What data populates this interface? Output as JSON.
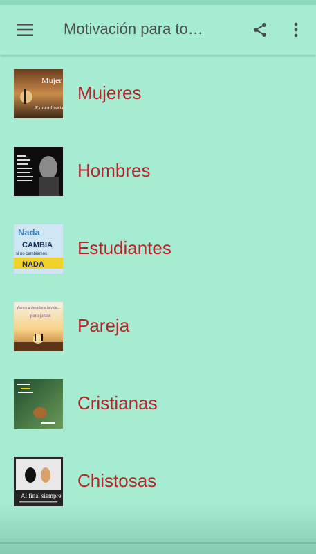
{
  "app_bar": {
    "title": "Motivación para to…",
    "icons": [
      "menu-icon",
      "share-icon",
      "more-vert-icon"
    ]
  },
  "categories": [
    {
      "label": "Mujeres",
      "thumb_text": [
        "Mujer",
        "Extraordinaria"
      ]
    },
    {
      "label": "Hombres",
      "thumb_text": []
    },
    {
      "label": "Estudiantes",
      "thumb_text": [
        "Nada",
        "CAMBIA",
        "si no cambiamos",
        "NADA"
      ]
    },
    {
      "label": "Pareja",
      "thumb_text": [
        "Vamos a desafiar a la vida...",
        "pero juntos"
      ]
    },
    {
      "label": "Cristianas",
      "thumb_text": []
    },
    {
      "label": "Chistosas",
      "thumb_text": [
        "Al final siempre"
      ]
    }
  ],
  "colors": {
    "background": "#a6ecd2",
    "title_text": "#4a4f4d",
    "label_text": "#b3262b"
  }
}
